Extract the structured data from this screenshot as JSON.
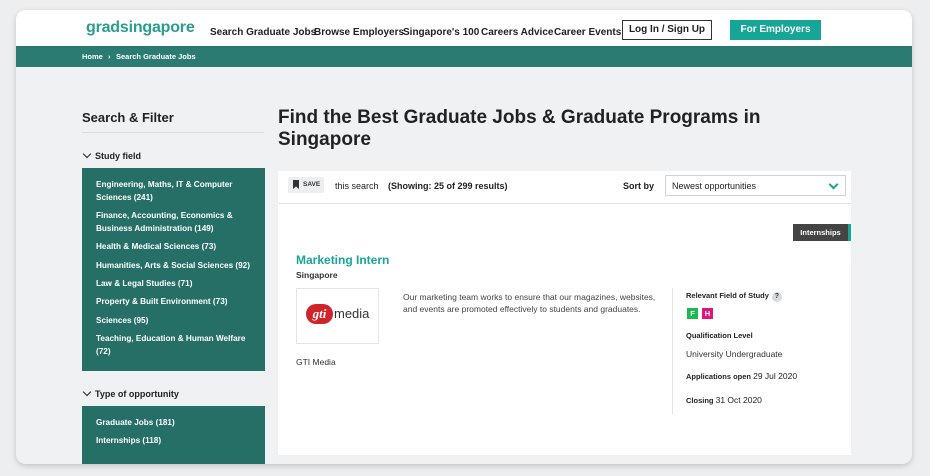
{
  "header": {
    "logo_text": "gradsingapore",
    "nav": [
      "Search Graduate Jobs",
      "Browse Employers",
      "Singapore's 100",
      "Careers Advice",
      "Career Events"
    ],
    "login_label": "Log In / Sign Up",
    "employers_label": "For Employers"
  },
  "breadcrumb": {
    "home": "Home",
    "sep": "›",
    "current": "Search Graduate Jobs"
  },
  "sidebar": {
    "title": "Search & Filter",
    "study_field": {
      "heading": "Study field",
      "items": [
        "Engineering, Maths, IT & Computer Sciences (241)",
        "Finance, Accounting, Economics & Business Administration (149)",
        "Health & Medical Sciences (73)",
        "Humanities, Arts & Social Sciences (92)",
        "Law & Legal Studies (71)",
        "Property & Built Environment (73)",
        "Sciences (95)",
        "Teaching, Education & Human Welfare (72)"
      ]
    },
    "opportunity": {
      "heading": "Type of opportunity",
      "items": [
        "Graduate Jobs (181)",
        "Internships (118)"
      ]
    }
  },
  "main": {
    "title": "Find the Best Graduate Jobs & Graduate Programs in Singapore",
    "toolbar": {
      "save_label": "SAVE",
      "this_search": "this search",
      "showing": "(Showing: 25 of 299 results)",
      "sort_label": "Sort by",
      "sort_value": "Newest opportunities"
    },
    "job": {
      "tag": "Internships",
      "title": "Marketing Intern",
      "location": "Singapore",
      "logo_mark": "gti",
      "logo_word": "media",
      "company": "GTI Media",
      "description": "Our marketing team works to ensure that our magazines, websites, and events are promoted effectively to students and graduates.",
      "field_label": "Relevant Field of Study",
      "field_help": "?",
      "field_badges": [
        {
          "letter": "F",
          "color": "#1db954"
        },
        {
          "letter": "H",
          "color": "#e0157a"
        }
      ],
      "qualification_label": "Qualification Level",
      "qualification_value": "University Undergraduate",
      "applications_open_label": "Applications open",
      "applications_open_value": "29 Jul 2020",
      "closing_label": "Closing",
      "closing_value": "31 Oct 2020"
    }
  },
  "colors": {
    "accent": "#16a596",
    "panel": "#256f67",
    "breadcrumb_bar": "#2b7b73"
  }
}
